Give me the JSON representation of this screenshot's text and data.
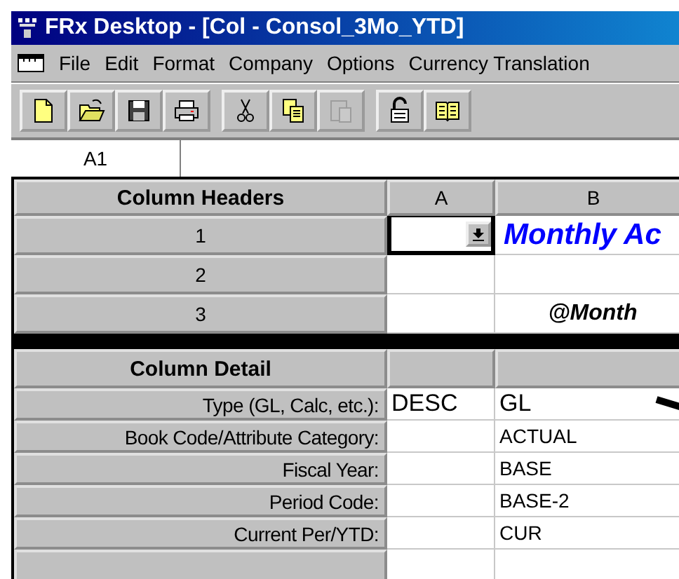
{
  "window": {
    "title": "FRx Desktop - [Col - Consol_3Mo_YTD]"
  },
  "menu": [
    "File",
    "Edit",
    "Format",
    "Company",
    "Options",
    "Currency Translation"
  ],
  "toolbar": [
    [
      {
        "kind": "new",
        "disabled": false
      },
      {
        "kind": "open",
        "disabled": false
      },
      {
        "kind": "save",
        "disabled": false
      },
      {
        "kind": "print",
        "disabled": false
      }
    ],
    [
      {
        "kind": "cut",
        "disabled": false
      },
      {
        "kind": "copy",
        "disabled": false
      },
      {
        "kind": "paste",
        "disabled": true
      }
    ],
    [
      {
        "kind": "lock",
        "disabled": false
      },
      {
        "kind": "book",
        "disabled": false
      }
    ]
  ],
  "cell_reference": "A1",
  "grid": {
    "columns": [
      "A",
      "B"
    ],
    "headers_title": "Column Headers",
    "header_rows": [
      {
        "label": "1",
        "cells": [
          {
            "text": "",
            "kind": "dropdown"
          },
          {
            "text": "Monthly Ac",
            "kind": "title"
          }
        ]
      },
      {
        "label": "2",
        "cells": [
          {
            "text": "",
            "kind": "plain"
          },
          {
            "text": "",
            "kind": "plain"
          }
        ]
      },
      {
        "label": "3",
        "cells": [
          {
            "text": "",
            "kind": "plain"
          },
          {
            "text": "@Month",
            "kind": "emphasis"
          }
        ]
      }
    ],
    "detail_title": "Column Detail",
    "detail_rows": [
      {
        "label": "Type (GL, Calc, etc.):",
        "cells": [
          "DESC",
          "GL"
        ]
      },
      {
        "label": "Book Code/Attribute Category:",
        "cells": [
          "",
          "ACTUAL"
        ]
      },
      {
        "label": "Fiscal Year:",
        "cells": [
          "",
          "BASE"
        ]
      },
      {
        "label": "Period Code:",
        "cells": [
          "",
          "BASE-2"
        ]
      },
      {
        "label": "Current Per/YTD:",
        "cells": [
          "",
          "CUR"
        ]
      },
      {
        "label": "",
        "cells": [
          "",
          ""
        ]
      }
    ]
  }
}
